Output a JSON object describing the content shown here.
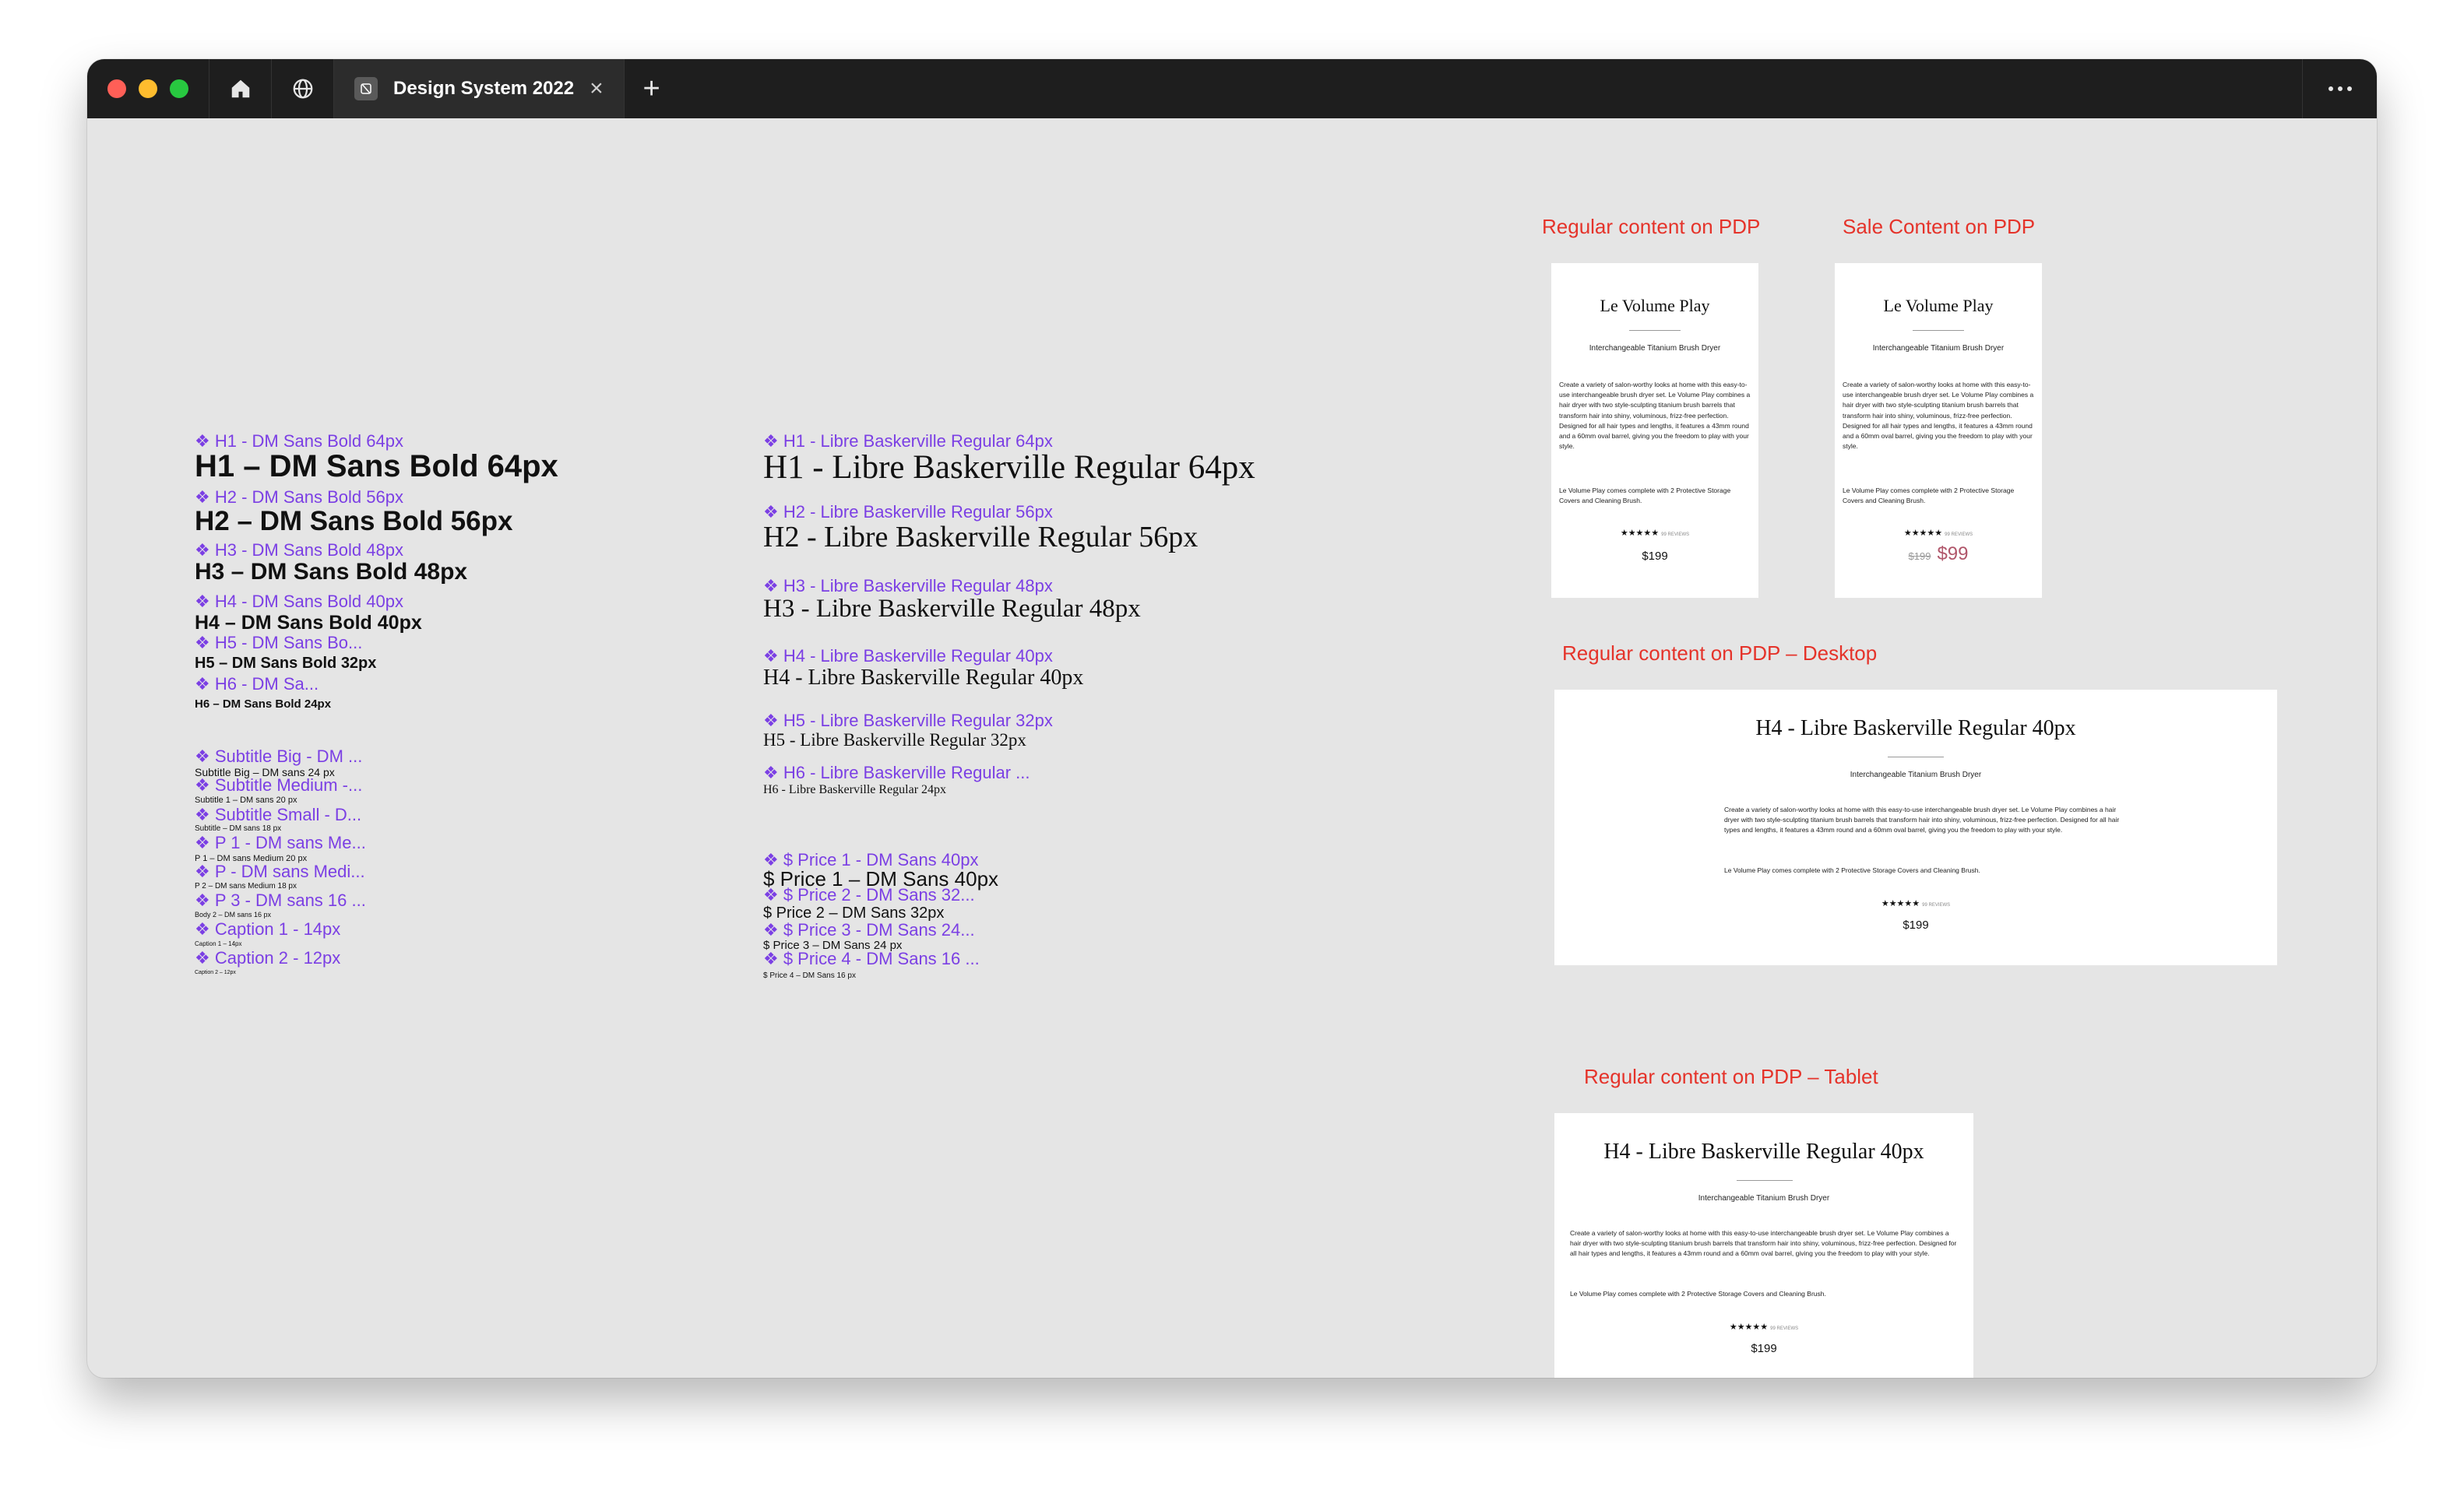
{
  "window": {
    "tab_title": "Design System 2022"
  },
  "left_column": {
    "items": [
      {
        "comp": "❖ H1 - DM Sans Bold 64px",
        "sample": "H1 – DM Sans Bold 64px"
      },
      {
        "comp": "❖ H2 - DM Sans Bold 56px",
        "sample": "H2 – DM Sans Bold 56px"
      },
      {
        "comp": "❖ H3 - DM Sans Bold 48px",
        "sample": "H3 – DM Sans Bold 48px"
      },
      {
        "comp": "❖ H4 - DM Sans Bold 40px",
        "sample": "H4 – DM Sans Bold 40px"
      },
      {
        "comp": "❖ H5 - DM Sans Bo...",
        "sample": "H5 – DM Sans Bold 32px"
      },
      {
        "comp": "❖ H6 - DM Sa...",
        "sample": "H6 – DM Sans Bold 24px"
      },
      {
        "comp": "❖ Subtitle Big - DM ...",
        "sample": "Subtitle Big – DM sans 24 px"
      },
      {
        "comp": "❖ Subtitle Medium -...",
        "sample": "Subtitle 1 – DM sans 20 px"
      },
      {
        "comp": "❖ Subtitle Small - D...",
        "sample": "Subtitle – DM sans 18 px"
      },
      {
        "comp": "❖ P 1 - DM sans Me...",
        "sample": "P 1 – DM sans Medium 20 px"
      },
      {
        "comp": "❖ P - DM sans Medi...",
        "sample": "P 2 – DM sans Medium 18 px"
      },
      {
        "comp": "❖ P 3 - DM sans 16 ...",
        "sample": "Body 2 – DM sans 16 px"
      },
      {
        "comp": "❖ Caption 1 - 14px",
        "sample": "Caption 1 – 14px"
      },
      {
        "comp": "❖ Caption 2 - 12px",
        "sample": "Caption 2 – 12px"
      }
    ]
  },
  "middle_column": {
    "items": [
      {
        "comp": "❖ H1 - Libre Baskerville Regular 64px",
        "sample": "H1 - Libre Baskerville Regular 64px"
      },
      {
        "comp": "❖ H2 - Libre Baskerville Regular 56px",
        "sample": "H2 - Libre Baskerville Regular 56px"
      },
      {
        "comp": "❖ H3 - Libre Baskerville Regular 48px",
        "sample": "H3 - Libre Baskerville Regular 48px"
      },
      {
        "comp": "❖ H4 - Libre Baskerville Regular 40px",
        "sample": "H4 - Libre Baskerville Regular 40px"
      },
      {
        "comp": "❖ H5 - Libre Baskerville Regular 32px",
        "sample": "H5 - Libre Baskerville Regular 32px"
      },
      {
        "comp": "❖ H6 - Libre Baskerville Regular ...",
        "sample": "H6 - Libre Baskerville Regular 24px"
      }
    ],
    "prices": [
      {
        "comp": "❖ $ Price 1 - DM Sans 40px",
        "sample": "$ Price 1 – DM Sans 40px"
      },
      {
        "comp": "❖ $ Price 2 - DM Sans 32...",
        "sample": "$ Price 2 – DM Sans 32px"
      },
      {
        "comp": "❖ $ Price 3 - DM Sans 24...",
        "sample": "$ Price 3 – DM Sans 24 px"
      },
      {
        "comp": "❖ $ Price 4 - DM Sans 16 ...",
        "sample": "$ Price 4 – DM Sans 16 px"
      }
    ]
  },
  "frames": {
    "regular": {
      "label": "Regular content on PDP",
      "title": "Le Volume Play",
      "subtitle": "Interchangeable Titanium Brush Dryer",
      "body1": "Create a variety of salon-worthy looks at home with this easy-to-use interchangeable brush dryer set. Le Volume Play combines a hair dryer with two style-sculpting titanium brush barrels that transform hair into shiny, voluminous, frizz-free perfection. Designed for all hair types and lengths, it features a 43mm round and a 60mm oval barrel, giving you the freedom to play with your style.",
      "body2": "Le Volume Play comes complete with 2 Protective Storage Covers and Cleaning Brush.",
      "stars": "★★★★★",
      "reviews": "99 REVIEWS",
      "price": "$199"
    },
    "sale": {
      "label": "Sale Content on PDP",
      "title": "Le Volume Play",
      "subtitle": "Interchangeable Titanium Brush Dryer",
      "body1": "Create a variety of salon-worthy looks at home with this easy-to-use interchangeable brush dryer set. Le Volume Play combines a hair dryer with two style-sculpting titanium brush barrels that transform hair into shiny, voluminous, frizz-free perfection. Designed for all hair types and lengths, it features a 43mm round and a 60mm oval barrel, giving you the freedom to play with your style.",
      "body2": "Le Volume Play comes complete with 2 Protective Storage Covers and Cleaning Brush.",
      "stars": "★★★★★",
      "reviews": "99 REVIEWS",
      "old_price": "$199",
      "sale_price": "$99"
    },
    "desktop": {
      "label": "Regular content on PDP – Desktop",
      "title": "H4 - Libre Baskerville Regular 40px",
      "subtitle": "Interchangeable Titanium Brush Dryer",
      "body1": "Create a variety of salon-worthy looks at home with this easy-to-use interchangeable brush dryer set. Le Volume Play combines a hair dryer with two style-sculpting titanium brush barrels that transform hair into shiny, voluminous, frizz-free perfection. Designed for all hair types and lengths, it features a 43mm round and a 60mm oval barrel, giving you the freedom to play with your style.",
      "body2": "Le Volume Play comes complete with 2 Protective Storage Covers and Cleaning Brush.",
      "stars": "★★★★★",
      "reviews": "99 REVIEWS",
      "price": "$199"
    },
    "tablet": {
      "label": "Regular content on PDP – Tablet",
      "title": "H4 - Libre Baskerville Regular 40px",
      "subtitle": "Interchangeable Titanium Brush Dryer",
      "body1": "Create a variety of salon-worthy looks at home with this easy-to-use interchangeable brush dryer set. Le Volume Play combines a hair dryer with two style-sculpting titanium brush barrels that transform hair into shiny, voluminous, frizz-free perfection. Designed for all hair types and lengths, it features a 43mm round and a 60mm oval barrel, giving you the freedom to play with your style.",
      "body2": "Le Volume Play comes complete with 2 Protective Storage Covers and Cleaning Brush.",
      "stars": "★★★★★",
      "reviews": "99 REVIEWS",
      "price": "$199"
    }
  },
  "colors": {
    "component_purple": "#7b3fe4",
    "frame_label_red": "#e5332a",
    "titlebar": "#1e1e1e",
    "canvas": "#e5e5e5"
  }
}
